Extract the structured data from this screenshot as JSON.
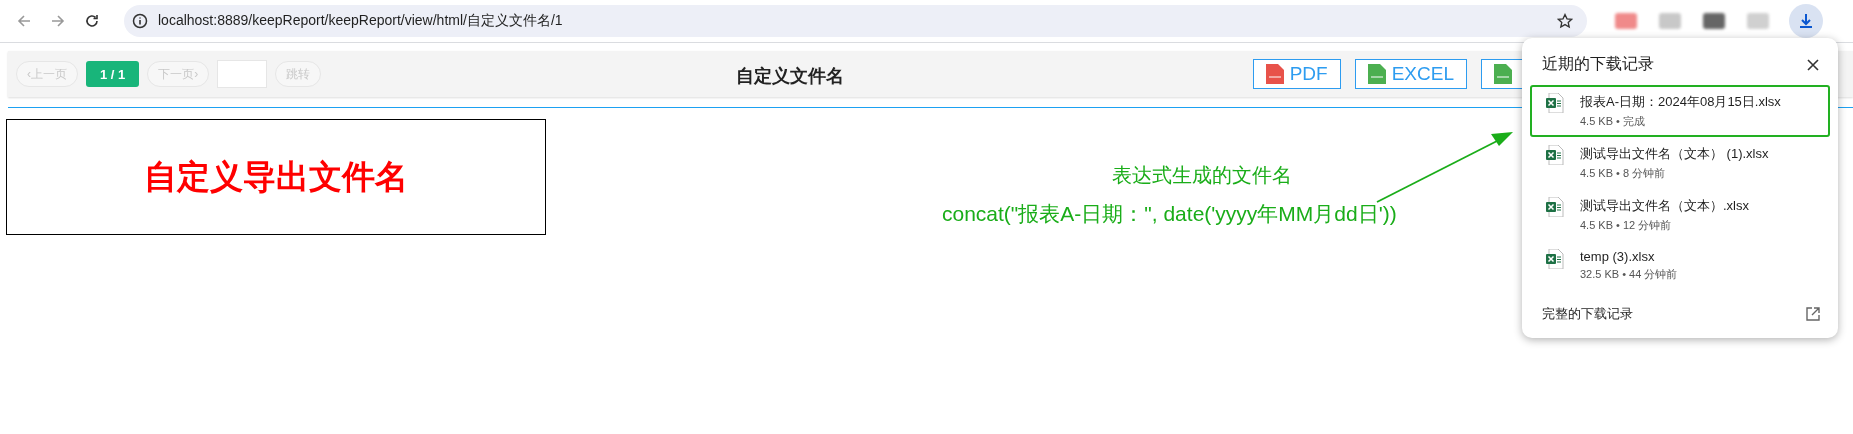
{
  "browser": {
    "url": "localhost:8889/keepReport/keepReport/view/html/自定义文件名/1"
  },
  "pager": {
    "prev_label": "‹上一页",
    "prev_disabled": true,
    "page": "1 / 1",
    "next_label": "下一页›",
    "next_disabled": true,
    "jump_label": "跳转",
    "jump_disabled": true
  },
  "toolbar_title": "自定义文件名",
  "export_buttons": [
    {
      "kind": "pdf",
      "label": "PDF"
    },
    {
      "kind": "excel",
      "label": "EXCEL"
    },
    {
      "kind": "excel"
    }
  ],
  "report": {
    "title": "自定义导出文件名"
  },
  "annotation": {
    "caption": "表达式生成的文件名",
    "expression": "concat(\"报表A-日期：\", date('yyyy年MM月dd日'))"
  },
  "downloads": {
    "title": "近期的下载记录",
    "items": [
      {
        "name": "报表A-日期：2024年08月15日.xlsx",
        "meta": "4.5 KB • 完成",
        "selected": true
      },
      {
        "name": "测试导出文件名（文本） (1).xlsx",
        "meta": "4.5 KB • 8 分钟前",
        "selected": false
      },
      {
        "name": "测试导出文件名（文本）.xlsx",
        "meta": "4.5 KB • 12 分钟前",
        "selected": false
      },
      {
        "name": "temp (3).xlsx",
        "meta": "32.5 KB • 44 分钟前",
        "selected": false
      }
    ],
    "footer": "完整的下载记录"
  }
}
